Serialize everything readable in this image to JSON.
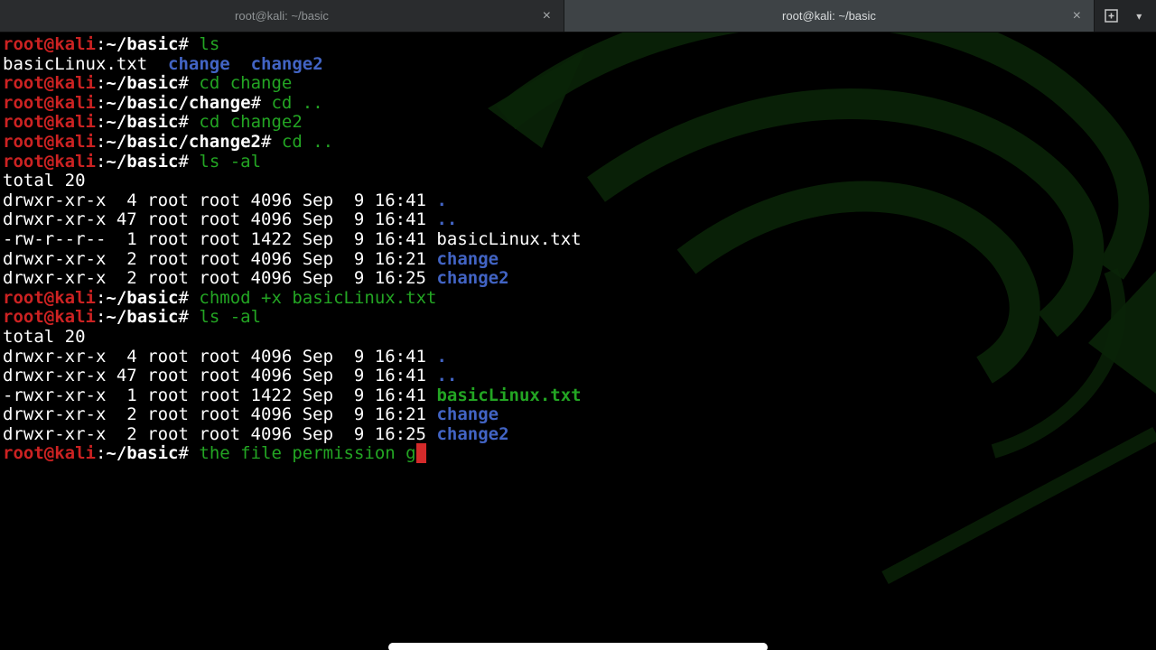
{
  "tab_bar": {
    "tabs": [
      {
        "title": "root@kali: ~/basic",
        "active": false,
        "close_icon": "×"
      },
      {
        "title": "root@kali: ~/basic",
        "active": true,
        "close_icon": "×"
      }
    ],
    "menu_icon": "▾"
  },
  "colors": {
    "background": "#000000",
    "foreground": "#ffffff",
    "prompt_red": "#cc2222",
    "command_green": "#23a523",
    "directory_blue": "#4264c4",
    "cursor_red": "#d42a2a",
    "watermark_green": "#0a2408"
  },
  "terminal": {
    "lines": [
      [
        {
          "t": "root@kali",
          "c": "r"
        },
        {
          "t": ":",
          "c": "w"
        },
        {
          "t": "~/basic",
          "c": "wb"
        },
        {
          "t": "# ",
          "c": "w"
        },
        {
          "t": "ls",
          "c": "g"
        }
      ],
      [
        {
          "t": "basicLinux.txt  ",
          "c": "w"
        },
        {
          "t": "change",
          "c": "bl"
        },
        {
          "t": "  ",
          "c": "w"
        },
        {
          "t": "change2",
          "c": "bl"
        }
      ],
      [
        {
          "t": "root@kali",
          "c": "r"
        },
        {
          "t": ":",
          "c": "w"
        },
        {
          "t": "~/basic",
          "c": "wb"
        },
        {
          "t": "# ",
          "c": "w"
        },
        {
          "t": "cd change",
          "c": "g"
        }
      ],
      [
        {
          "t": "root@kali",
          "c": "r"
        },
        {
          "t": ":",
          "c": "w"
        },
        {
          "t": "~/basic/change",
          "c": "wb"
        },
        {
          "t": "# ",
          "c": "w"
        },
        {
          "t": "cd ..",
          "c": "g"
        }
      ],
      [
        {
          "t": "root@kali",
          "c": "r"
        },
        {
          "t": ":",
          "c": "w"
        },
        {
          "t": "~/basic",
          "c": "wb"
        },
        {
          "t": "# ",
          "c": "w"
        },
        {
          "t": "cd change2",
          "c": "g"
        }
      ],
      [
        {
          "t": "root@kali",
          "c": "r"
        },
        {
          "t": ":",
          "c": "w"
        },
        {
          "t": "~/basic/change2",
          "c": "wb"
        },
        {
          "t": "# ",
          "c": "w"
        },
        {
          "t": "cd ..",
          "c": "g"
        }
      ],
      [
        {
          "t": "root@kali",
          "c": "r"
        },
        {
          "t": ":",
          "c": "w"
        },
        {
          "t": "~/basic",
          "c": "wb"
        },
        {
          "t": "# ",
          "c": "w"
        },
        {
          "t": "ls -al",
          "c": "g"
        }
      ],
      [
        {
          "t": "total 20",
          "c": "w"
        }
      ],
      [
        {
          "t": "drwxr-xr-x  4 root root 4096 Sep  9 16:41 ",
          "c": "w"
        },
        {
          "t": ".",
          "c": "bl"
        }
      ],
      [
        {
          "t": "drwxr-xr-x 47 root root 4096 Sep  9 16:41 ",
          "c": "w"
        },
        {
          "t": "..",
          "c": "bl"
        }
      ],
      [
        {
          "t": "-rw-r--r--  1 root root 1422 Sep  9 16:41 basicLinux.txt",
          "c": "w"
        }
      ],
      [
        {
          "t": "drwxr-xr-x  2 root root 4096 Sep  9 16:21 ",
          "c": "w"
        },
        {
          "t": "change",
          "c": "bl"
        }
      ],
      [
        {
          "t": "drwxr-xr-x  2 root root 4096 Sep  9 16:25 ",
          "c": "w"
        },
        {
          "t": "change2",
          "c": "bl"
        }
      ],
      [
        {
          "t": "root@kali",
          "c": "r"
        },
        {
          "t": ":",
          "c": "w"
        },
        {
          "t": "~/basic",
          "c": "wb"
        },
        {
          "t": "# ",
          "c": "w"
        },
        {
          "t": "chmod +x basicLinux.txt",
          "c": "g"
        }
      ],
      [
        {
          "t": "root@kali",
          "c": "r"
        },
        {
          "t": ":",
          "c": "w"
        },
        {
          "t": "~/basic",
          "c": "wb"
        },
        {
          "t": "# ",
          "c": "w"
        },
        {
          "t": "ls -al",
          "c": "g"
        }
      ],
      [
        {
          "t": "total 20",
          "c": "w"
        }
      ],
      [
        {
          "t": "drwxr-xr-x  4 root root 4096 Sep  9 16:41 ",
          "c": "w"
        },
        {
          "t": ".",
          "c": "bl"
        }
      ],
      [
        {
          "t": "drwxr-xr-x 47 root root 4096 Sep  9 16:41 ",
          "c": "w"
        },
        {
          "t": "..",
          "c": "bl"
        }
      ],
      [
        {
          "t": "-rwxr-xr-x  1 root root 1422 Sep  9 16:41 ",
          "c": "w"
        },
        {
          "t": "basicLinux.txt",
          "c": "gb"
        }
      ],
      [
        {
          "t": "drwxr-xr-x  2 root root 4096 Sep  9 16:21 ",
          "c": "w"
        },
        {
          "t": "change",
          "c": "bl"
        }
      ],
      [
        {
          "t": "drwxr-xr-x  2 root root 4096 Sep  9 16:25 ",
          "c": "w"
        },
        {
          "t": "change2",
          "c": "bl"
        }
      ],
      [
        {
          "t": "root@kali",
          "c": "r"
        },
        {
          "t": ":",
          "c": "w"
        },
        {
          "t": "~/basic",
          "c": "wb"
        },
        {
          "t": "# ",
          "c": "w"
        },
        {
          "t": "the file permission g",
          "c": "g"
        },
        {
          "t": " ",
          "c": "cur"
        }
      ]
    ]
  }
}
